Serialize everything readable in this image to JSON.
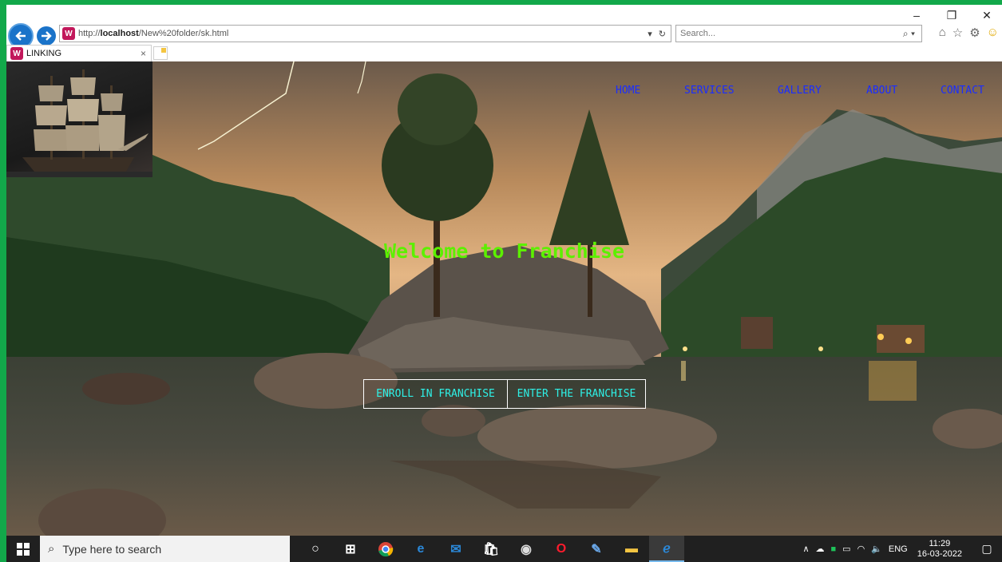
{
  "browser": {
    "url_prefix": "http://",
    "url_host": "localhost",
    "url_path": "/New%20folder/sk.html",
    "search_placeholder": "Search...",
    "tab_title": "LINKING",
    "window_minimize": "–",
    "window_restore": "❐",
    "window_close": "✕",
    "site_icon": "W"
  },
  "nav": {
    "items": [
      "HOME",
      "SERVICES",
      "GALLERY",
      "ABOUT",
      "CONTACT"
    ]
  },
  "hero": {
    "welcome": "Welcome to Franchise",
    "enroll_button": "ENROLL IN FRANCHISE",
    "enter_button": "ENTER THE FRANCHISE"
  },
  "taskbar": {
    "search_placeholder": "Type here to search",
    "language": "ENG",
    "time": "11:29",
    "date": "16-03-2022"
  },
  "colors": {
    "nav_link": "#1a2dff",
    "welcome_text": "#5cf000",
    "button_text": "#2ef0e6",
    "window_border": "#12a84a"
  },
  "icons": [
    "back-arrow-icon",
    "forward-arrow-icon",
    "refresh-icon",
    "search-icon",
    "home-icon",
    "favorites-star-icon",
    "settings-gear-icon",
    "smiley-feedback-icon",
    "windows-start-icon",
    "cortana-icon",
    "task-view-icon",
    "chrome-icon",
    "edge-icon",
    "mail-icon",
    "store-icon",
    "media-icon",
    "opera-icon",
    "notepad-icon",
    "file-explorer-icon",
    "ie-icon",
    "notification-icon"
  ]
}
